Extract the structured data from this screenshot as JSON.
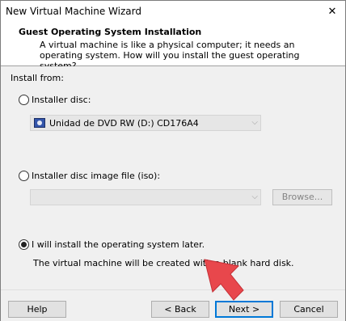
{
  "window": {
    "title": "New Virtual Machine Wizard"
  },
  "header": {
    "title": "Guest Operating System Installation",
    "description": "A virtual machine is like a physical computer; it needs an operating system. How will you install the guest operating system?"
  },
  "install_from_label": "Install from:",
  "options": {
    "installer_disc": {
      "label": "Installer disc:",
      "selected": false
    },
    "disc_select_value": "Unidad de DVD RW (D:) CD176A4",
    "iso": {
      "label": "Installer disc image file (iso):",
      "selected": false
    },
    "iso_path_value": "",
    "browse_label": "Browse...",
    "later": {
      "label": "I will install the operating system later.",
      "selected": true
    },
    "later_description": "The virtual machine will be created with a blank hard disk."
  },
  "footer": {
    "help_label": "Help",
    "back_label": "< Back",
    "next_label": "Next >",
    "cancel_label": "Cancel"
  },
  "colors": {
    "accent": "#0078d7",
    "pointer": "#e8474c",
    "panel": "#f0f0f0"
  }
}
